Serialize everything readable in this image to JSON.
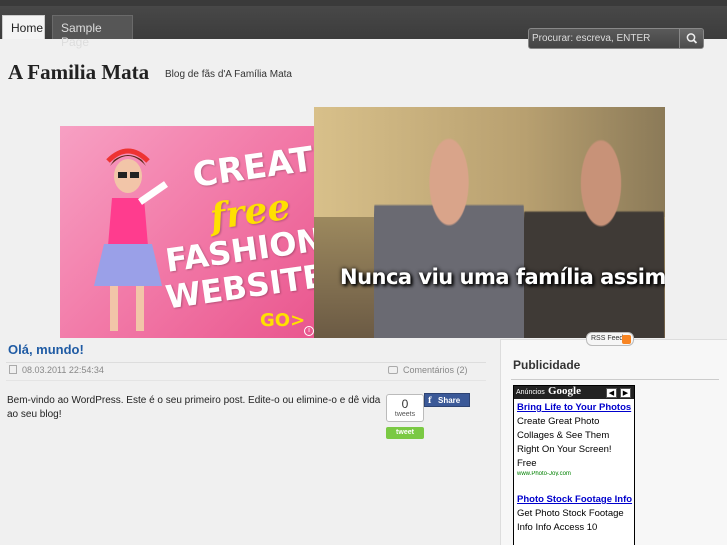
{
  "nav": {
    "items": [
      {
        "label": "Home"
      },
      {
        "label": "Sample Page"
      }
    ]
  },
  "search": {
    "placeholder": "Procurar: escreva, ENTER"
  },
  "header": {
    "title": "A Familia Mata",
    "description": "Blog de fãs d'A Família Mata"
  },
  "banner": {
    "ad_lines": [
      "CREATE",
      "free",
      "FASHION",
      "WEBSITES"
    ],
    "ad_cta": "GO>",
    "ad_info": "i",
    "caption": "Nunca viu uma família assim!"
  },
  "post": {
    "title": "Olá, mundo!",
    "date": "08.03.2011 22:54:34",
    "comments": "Comentários (2)",
    "body": "Bem-vindo ao WordPress. Este é o seu primeiro post. Edite-o ou elimine-o e dê vida ao seu blog!",
    "tweet_count": "0",
    "tweet_label": "tweets",
    "tweet_button": "tweet",
    "share_label": "Share",
    "share_icon": "f"
  },
  "sidebar": {
    "rss_label": "RSS Feed",
    "title": "Publicidade",
    "ads": {
      "header_label": "Anúncios",
      "brand": "Google",
      "prev": "◀",
      "next": "▶",
      "units": [
        {
          "title": "Bring Life to Your Photos",
          "text": "Create Great Photo Collages & See Them Right On Your Screen! Free",
          "url": "www.Photo-Joy.com"
        },
        {
          "title": "Photo Stock Footage Info",
          "text": "Get Photo Stock Footage Info Info Access 10"
        }
      ]
    }
  },
  "colors": {
    "link": "#1f5ba4",
    "nav_bg": "#3c3c3c",
    "ad_link": "#0000cc",
    "ad_url": "#008000"
  }
}
